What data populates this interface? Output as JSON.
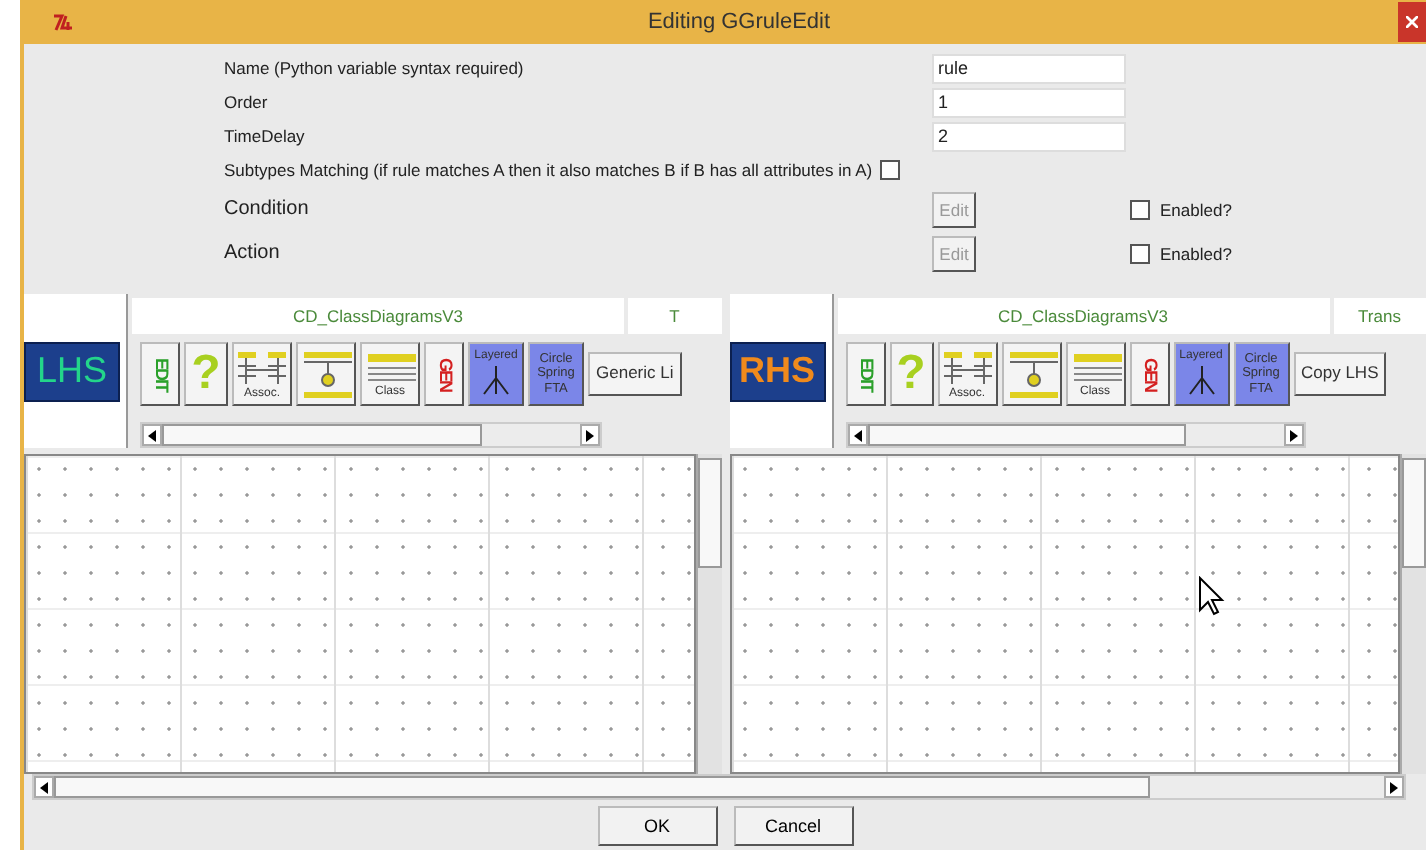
{
  "window": {
    "title": "Editing GGruleEdit"
  },
  "form": [
    {
      "kind": "text",
      "label": "Name (Python variable syntax required)",
      "value": "rule"
    },
    {
      "kind": "text",
      "label": "Order",
      "value": "1"
    },
    {
      "kind": "text",
      "label": "TimeDelay",
      "value": "2"
    },
    {
      "kind": "checkbox",
      "label": "Subtypes Matching (if rule matches A then it also matches B if B has all attributes in A)",
      "checked": false
    },
    {
      "kind": "edit",
      "label": "Condition",
      "button": "Edit",
      "disabled": true,
      "option": "Enabled?",
      "enabled": false
    },
    {
      "kind": "edit",
      "label": "Action",
      "button": "Edit",
      "disabled": true,
      "option": "Enabled?",
      "enabled": false
    }
  ],
  "panels": [
    {
      "badge": "LHS",
      "kind": "left",
      "tabs": [
        "CD_ClassDiagramsV3",
        "T"
      ],
      "tools": [
        {
          "kind": "edit",
          "label": "EDIT"
        },
        {
          "kind": "help",
          "label": "?"
        },
        {
          "kind": "assoc",
          "label": "Assoc."
        },
        {
          "kind": "inherit"
        },
        {
          "kind": "class",
          "label": "Class"
        },
        {
          "kind": "gen",
          "label": "GEN"
        },
        {
          "kind": "layered",
          "label": "Layered"
        },
        {
          "kind": "spring",
          "label": "Circle Spring FTA"
        },
        {
          "kind": "text",
          "label": "Generic Li"
        }
      ],
      "cursor": false
    },
    {
      "badge": "RHS",
      "kind": "right",
      "tabs": [
        "CD_ClassDiagramsV3",
        "Trans"
      ],
      "tools": [
        {
          "kind": "edit",
          "label": "EDIT"
        },
        {
          "kind": "help",
          "label": "?"
        },
        {
          "kind": "assoc",
          "label": "Assoc."
        },
        {
          "kind": "inherit"
        },
        {
          "kind": "class",
          "label": "Class"
        },
        {
          "kind": "gen",
          "label": "GEN"
        },
        {
          "kind": "layered",
          "label": "Layered"
        },
        {
          "kind": "spring",
          "label": "Circle Spring FTA"
        },
        {
          "kind": "text",
          "label": "Copy LHS"
        }
      ],
      "cursor": true
    }
  ],
  "buttons": [
    "OK",
    "Cancel"
  ]
}
